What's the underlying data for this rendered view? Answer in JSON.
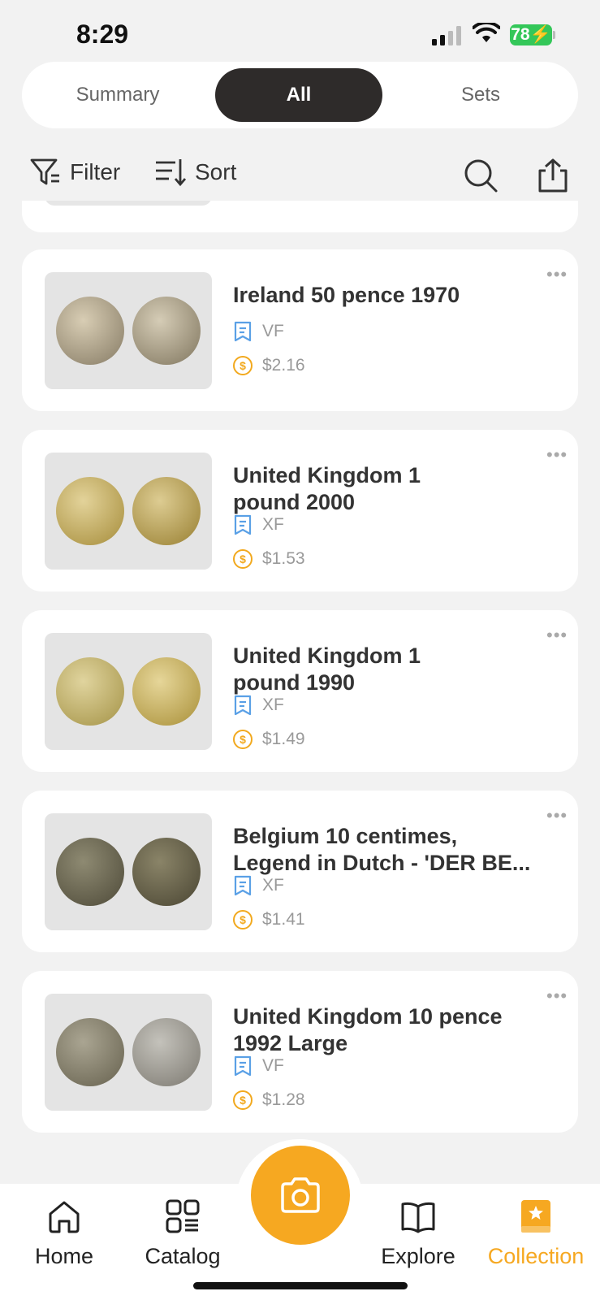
{
  "status": {
    "time": "8:29",
    "battery": "78"
  },
  "segments": [
    {
      "label": "Summary",
      "active": false
    },
    {
      "label": "All",
      "active": true
    },
    {
      "label": "Sets",
      "active": false
    }
  ],
  "toolbar": {
    "filter_label": "Filter",
    "sort_label": "Sort"
  },
  "items": [
    {
      "title_line1": "Ireland 50 pence 1970",
      "title_line2": "",
      "grade": "VF",
      "price": "$2.16"
    },
    {
      "title_line1": "United Kingdom 1",
      "title_line2": "pound 2000",
      "grade": "XF",
      "price": "$1.53"
    },
    {
      "title_line1": "United Kingdom 1",
      "title_line2": "pound 1990",
      "grade": "XF",
      "price": "$1.49"
    },
    {
      "title_line1": "Belgium 10 centimes,",
      "title_line2": "Legend in Dutch - 'DER BE...",
      "grade": "XF",
      "price": "$1.41"
    },
    {
      "title_line1": "United Kingdom 10 pence",
      "title_line2": "1992 Large",
      "grade": "VF",
      "price": "$1.28"
    }
  ],
  "tabbar": {
    "home": "Home",
    "catalog": "Catalog",
    "explore": "Explore",
    "collection": "Collection"
  },
  "colors": {
    "accent": "#f6a821",
    "dark": "#2e2b2a",
    "grade_icon": "#5aa0e6"
  }
}
